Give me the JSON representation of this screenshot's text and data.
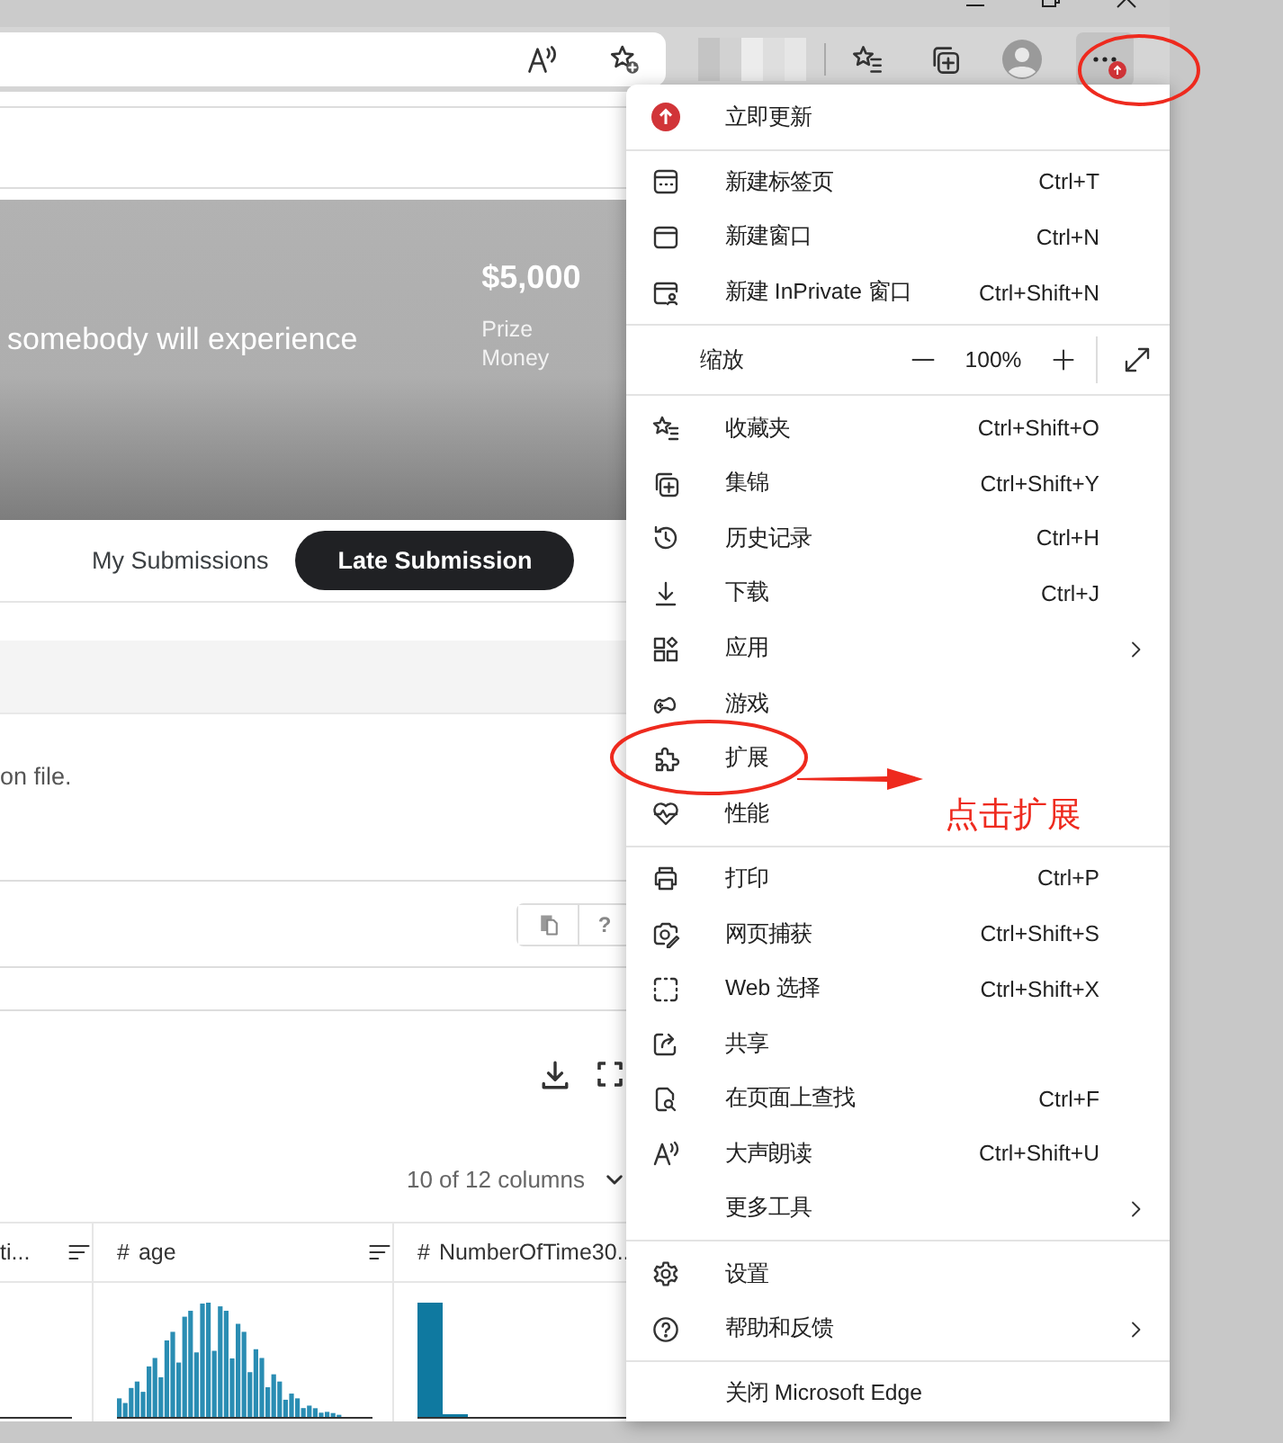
{
  "page": {
    "banner": {
      "tagline": "somebody will experience",
      "prize": "$5,000",
      "prize_label": "Prize Money"
    },
    "nav": [
      {
        "label": "My Submissions",
        "kind": "link"
      },
      {
        "label": "Late Submission",
        "kind": "button"
      }
    ],
    "description": "on file.",
    "help_button": "?",
    "columns_picker": "10 of 12 columns",
    "columns": [
      {
        "name": "ti..."
      },
      {
        "type": "#",
        "name": "age"
      },
      {
        "type": "#",
        "name": "NumberOfTime30.."
      }
    ]
  },
  "menu": {
    "sections": [
      {
        "items": [
          {
            "kind": "update",
            "label": "立即更新"
          }
        ]
      },
      {
        "items": [
          {
            "kind": "item",
            "label": "新建标签页",
            "shortcut": "Ctrl+T",
            "submenu": false
          },
          {
            "kind": "item",
            "label": "新建窗口",
            "shortcut": "Ctrl+N",
            "submenu": false
          },
          {
            "kind": "item",
            "label": "新建 InPrivate 窗口",
            "shortcut": "Ctrl+Shift+N",
            "submenu": false
          }
        ]
      },
      {
        "items": [
          {
            "kind": "zoom",
            "label": "缩放",
            "value": "100%"
          }
        ]
      },
      {
        "items": [
          {
            "kind": "item",
            "label": "收藏夹",
            "shortcut": "Ctrl+Shift+O",
            "submenu": false
          },
          {
            "kind": "item",
            "label": "集锦",
            "shortcut": "Ctrl+Shift+Y",
            "submenu": false
          },
          {
            "kind": "item",
            "label": "历史记录",
            "shortcut": "Ctrl+H",
            "submenu": false
          },
          {
            "kind": "item",
            "label": "下载",
            "shortcut": "Ctrl+J",
            "submenu": false
          },
          {
            "kind": "item",
            "label": "应用",
            "submenu": true
          },
          {
            "kind": "item",
            "label": "游戏",
            "submenu": false
          },
          {
            "kind": "item",
            "label": "扩展",
            "submenu": false
          },
          {
            "kind": "item",
            "label": "性能",
            "submenu": false
          }
        ]
      },
      {
        "items": [
          {
            "kind": "item",
            "label": "打印",
            "shortcut": "Ctrl+P",
            "submenu": false
          },
          {
            "kind": "item",
            "label": "网页捕获",
            "shortcut": "Ctrl+Shift+S",
            "submenu": false
          },
          {
            "kind": "item",
            "label": "Web 选择",
            "shortcut": "Ctrl+Shift+X",
            "submenu": false
          },
          {
            "kind": "item",
            "label": "共享",
            "submenu": false
          },
          {
            "kind": "item",
            "label": "在页面上查找",
            "shortcut": "Ctrl+F",
            "submenu": false
          },
          {
            "kind": "item",
            "label": "大声朗读",
            "shortcut": "Ctrl+Shift+U",
            "submenu": false
          },
          {
            "kind": "item",
            "label": "更多工具",
            "submenu": true
          }
        ]
      },
      {
        "items": [
          {
            "kind": "item",
            "label": "设置",
            "submenu": false
          },
          {
            "kind": "item",
            "label": "帮助和反馈",
            "submenu": true
          }
        ]
      },
      {
        "items": [
          {
            "kind": "item",
            "label": "关闭 Microsoft Edge",
            "submenu": false
          }
        ]
      }
    ]
  },
  "annotation": {
    "label": "点击扩展"
  }
}
